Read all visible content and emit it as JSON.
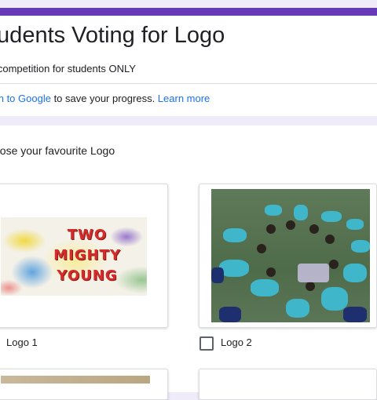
{
  "form": {
    "title": "tudents Voting for Logo",
    "description": "o competition for students ONLY",
    "signin_link": "n in to Google",
    "signin_text": " to save your progress. ",
    "learn_more": "Learn more",
    "accent_color": "#673ab7",
    "link_color": "#1a73e8"
  },
  "question": {
    "text": "oose your favourite Logo",
    "options": [
      {
        "label": "Logo 1",
        "checked": false,
        "image": "logo-two-mighty-young",
        "image_text": [
          "TWO",
          "MIGHTY",
          "YOUNG"
        ]
      },
      {
        "label": "Logo 2",
        "checked": false,
        "image": "photo-kids-lying-in-circle"
      }
    ]
  }
}
